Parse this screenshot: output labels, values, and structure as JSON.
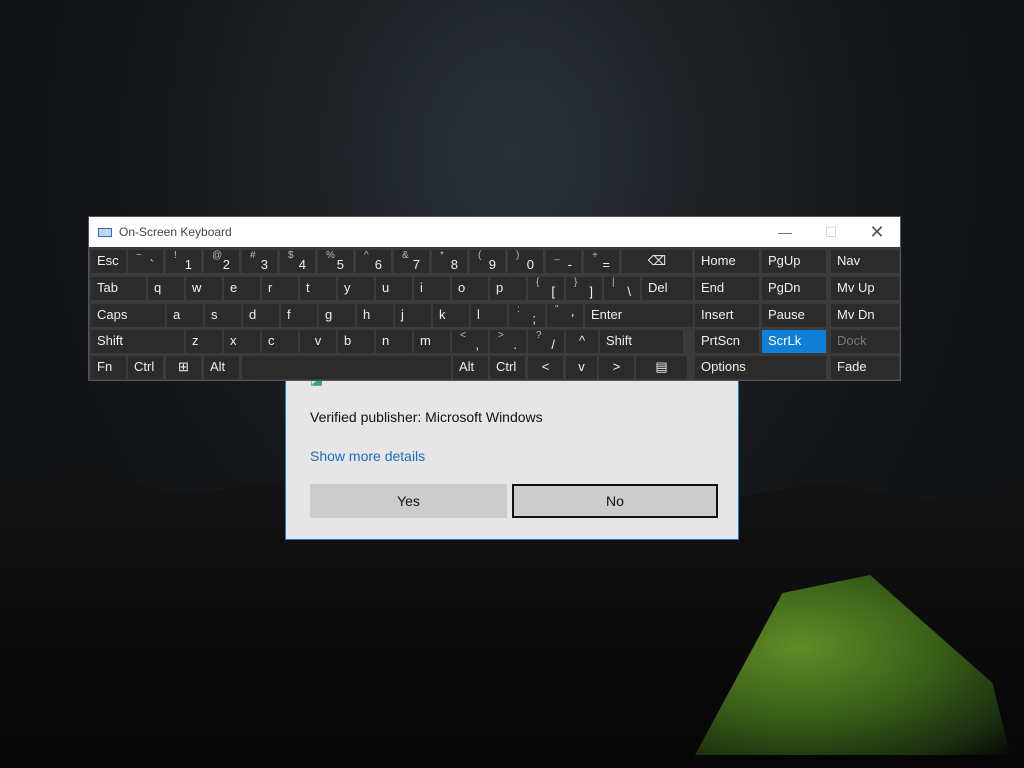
{
  "osk": {
    "title": "On-Screen Keyboard",
    "window_controls": {
      "minimize": "—",
      "maximize": "☐",
      "close": "✕"
    },
    "rows": [
      [
        {
          "main": "Esc"
        },
        {
          "top": "~",
          "bottom": "`"
        },
        {
          "top": "!",
          "bottom": "1"
        },
        {
          "top": "@",
          "bottom": "2"
        },
        {
          "top": "#",
          "bottom": "3"
        },
        {
          "top": "$",
          "bottom": "4"
        },
        {
          "top": "%",
          "bottom": "5"
        },
        {
          "top": "^",
          "bottom": "6"
        },
        {
          "top": "&",
          "bottom": "7"
        },
        {
          "top": "*",
          "bottom": "8"
        },
        {
          "top": "(",
          "bottom": "9"
        },
        {
          "top": ")",
          "bottom": "0"
        },
        {
          "top": "_",
          "bottom": "-"
        },
        {
          "top": "+",
          "bottom": "="
        },
        {
          "main": "⌫"
        },
        {
          "main": "Home"
        },
        {
          "main": "PgUp"
        },
        {
          "main": "Nav"
        }
      ],
      [
        {
          "main": "Tab"
        },
        {
          "main": "q"
        },
        {
          "main": "w"
        },
        {
          "main": "e"
        },
        {
          "main": "r"
        },
        {
          "main": "t"
        },
        {
          "main": "y"
        },
        {
          "main": "u"
        },
        {
          "main": "i"
        },
        {
          "main": "o"
        },
        {
          "main": "p"
        },
        {
          "top": "{",
          "bottom": "["
        },
        {
          "top": "}",
          "bottom": "]"
        },
        {
          "top": "|",
          "bottom": "\\"
        },
        {
          "main": "Del"
        },
        {
          "main": "End"
        },
        {
          "main": "PgDn"
        },
        {
          "main": "Mv Up"
        }
      ],
      [
        {
          "main": "Caps"
        },
        {
          "main": "a"
        },
        {
          "main": "s"
        },
        {
          "main": "d"
        },
        {
          "main": "f"
        },
        {
          "main": "g"
        },
        {
          "main": "h"
        },
        {
          "main": "j"
        },
        {
          "main": "k"
        },
        {
          "main": "l"
        },
        {
          "top": ":",
          "bottom": ";"
        },
        {
          "top": "\"",
          "bottom": "'"
        },
        {
          "main": "Enter"
        },
        {
          "main": "Insert"
        },
        {
          "main": "Pause"
        },
        {
          "main": "Mv Dn"
        }
      ],
      [
        {
          "main": "Shift"
        },
        {
          "main": "z"
        },
        {
          "main": "x"
        },
        {
          "main": "c"
        },
        {
          "main": "v"
        },
        {
          "main": "b"
        },
        {
          "main": "n"
        },
        {
          "main": "m"
        },
        {
          "top": "<",
          "bottom": ","
        },
        {
          "top": ">",
          "bottom": "."
        },
        {
          "top": "?",
          "bottom": "/"
        },
        {
          "main": "^"
        },
        {
          "main": "Shift"
        },
        {
          "main": "PrtScn"
        },
        {
          "main": "ScrLk"
        },
        {
          "main": "Dock"
        }
      ],
      [
        {
          "main": "Fn"
        },
        {
          "main": "Ctrl"
        },
        {
          "main": "⊞"
        },
        {
          "main": "Alt"
        },
        {
          "main": ""
        },
        {
          "main": "Alt"
        },
        {
          "main": "Ctrl"
        },
        {
          "main": "<"
        },
        {
          "main": "v"
        },
        {
          "main": ">"
        },
        {
          "main": "▤"
        },
        {
          "main": "Options"
        },
        {
          "main": "Fade"
        }
      ]
    ],
    "active_key": "ScrLk",
    "disabled_key": "Dock",
    "accent_color": "#0f7fd7"
  },
  "uac": {
    "publisher": "Verified publisher: Microsoft Windows",
    "more_details": "Show more details",
    "yes_label": "Yes",
    "no_label": "No"
  }
}
